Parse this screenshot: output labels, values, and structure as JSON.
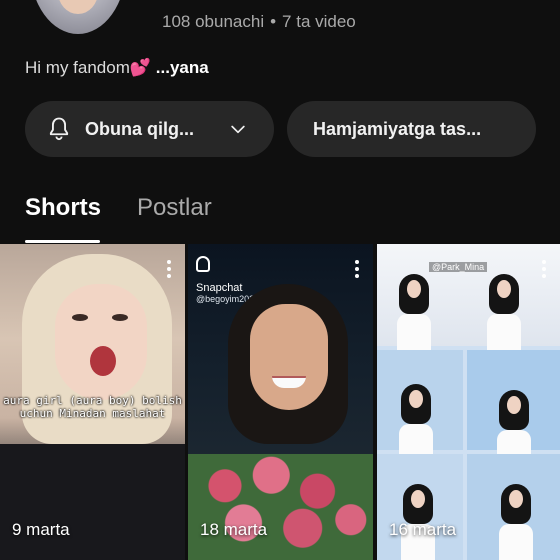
{
  "channel": {
    "subscribers": "108 obunachi",
    "separator": "•",
    "videos": "7 ta video",
    "bio_text": "Hi my fandom",
    "bio_heart": "💕",
    "bio_more": " ...yana"
  },
  "actions": {
    "subscribe_label": "Obuna qilg...",
    "community_label": "Hamjamiyatga tas..."
  },
  "tabs": [
    {
      "label": "Shorts",
      "selected": true
    },
    {
      "label": "Postlar",
      "selected": false
    }
  ],
  "shorts": [
    {
      "views": "9 marta",
      "caption": "aura girl (aura boy) bolish\nuchun Minadan maslahat"
    },
    {
      "views": "18 marta",
      "overlay_app": "Snapchat",
      "overlay_user": "@begoyim20243155"
    },
    {
      "views": "16 marta",
      "overlay_handle": "@Park_Mina"
    }
  ],
  "colors": {
    "background": "#0f0f0f",
    "button_bg": "#272727",
    "text_primary": "#f1f1f1",
    "text_secondary": "#aaaaaa"
  },
  "icons": {
    "subscribe": "bell-icon",
    "subscribe_menu": "chevron-down-icon",
    "short_menu": "more-vert-icon"
  }
}
